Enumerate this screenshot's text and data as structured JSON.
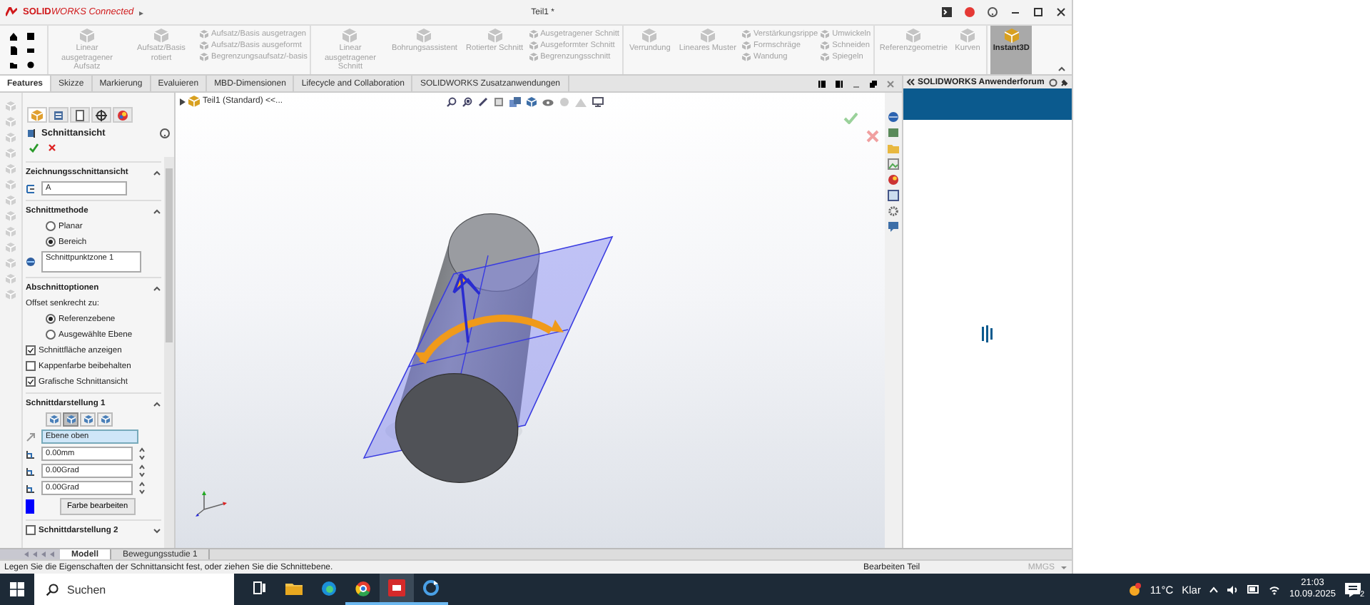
{
  "title_bar": {
    "logo": "**SOLID**WORKS Connected",
    "expand_arrow": "▸",
    "document": "Teil1 *"
  },
  "ribbon": {
    "groups": [
      {
        "tools": [
          {
            "kind": "large",
            "label": "Linear ausgetragener Aufsatz",
            "selected": false
          },
          {
            "kind": "large",
            "label": "Aufsatz/Basis rotiert",
            "selected": false
          },
          {
            "kind": "stack",
            "items": [
              "Aufsatz/Basis ausgetragen",
              "Aufsatz/Basis ausgeformt",
              "Begrenzungsaufsatz/-basis"
            ]
          }
        ]
      },
      {
        "tools": [
          {
            "kind": "large",
            "label": "Linear ausgetragener Schnitt",
            "selected": false
          },
          {
            "kind": "large",
            "label": "Bohrungsassistent",
            "selected": false
          },
          {
            "kind": "large",
            "label": "Rotierter Schnitt",
            "selected": false
          },
          {
            "kind": "stack",
            "items": [
              "Ausgetragener Schnitt",
              "Ausgeformter Schnitt",
              "Begrenzungsschnitt"
            ]
          }
        ]
      },
      {
        "tools": [
          {
            "kind": "large",
            "label": "Verrundung",
            "selected": false
          },
          {
            "kind": "large",
            "label": "Lineares Muster",
            "selected": false
          },
          {
            "kind": "stack",
            "items": [
              "Verstärkungsrippe",
              "Formschräge",
              "Wandung"
            ]
          },
          {
            "kind": "stack",
            "items": [
              "Umwickeln",
              "Schneiden",
              "Spiegeln"
            ]
          }
        ]
      },
      {
        "tools": [
          {
            "kind": "large",
            "label": "Referenzgeometrie",
            "selected": false
          },
          {
            "kind": "large",
            "label": "Kurven",
            "selected": false
          }
        ]
      },
      {
        "tools": [
          {
            "kind": "large",
            "label": "Instant3D",
            "selected": true
          }
        ]
      }
    ]
  },
  "command_tabs": [
    {
      "label": "Features",
      "selected": true
    },
    {
      "label": "Skizze",
      "selected": false
    },
    {
      "label": "Markierung",
      "selected": false
    },
    {
      "label": "Evaluieren",
      "selected": false
    },
    {
      "label": "MBD-Dimensionen",
      "selected": false
    },
    {
      "label": "Lifecycle and Collaboration",
      "selected": false
    },
    {
      "label": "SOLIDWORKS Zusatzanwendungen",
      "selected": false
    }
  ],
  "property_manager": {
    "title": "Schnittansicht",
    "sections": [
      {
        "title": "Zeichnungsschnittansicht",
        "expanded": true,
        "items": [
          {
            "kind": "field",
            "value": "A"
          }
        ]
      },
      {
        "title": "Schnittmethode",
        "expanded": true,
        "items": [
          {
            "kind": "radio",
            "label": "Planar",
            "selected": false
          },
          {
            "kind": "radio",
            "label": "Bereich",
            "selected": true
          },
          {
            "kind": "list",
            "value": "Schnittpunktzone 1"
          }
        ]
      },
      {
        "title": "Abschnittoptionen",
        "expanded": true,
        "items": [
          {
            "kind": "label",
            "text": "Offset senkrecht zu:"
          },
          {
            "kind": "radio",
            "label": "Referenzebene",
            "selected": true
          },
          {
            "kind": "radio",
            "label": "Ausgewählte Ebene",
            "selected": false
          },
          {
            "kind": "checkbox",
            "label": "Schnittfläche anzeigen",
            "checked": true
          },
          {
            "kind": "checkbox",
            "label": "Kappenfarbe beibehalten",
            "checked": false
          },
          {
            "kind": "checkbox",
            "label": "Grafische Schnittansicht",
            "checked": true
          }
        ]
      },
      {
        "title": "Schnittdarstellung 1",
        "expanded": true,
        "items": [
          {
            "kind": "modes",
            "buttons": [
              {
                "selected": false
              },
              {
                "selected": true
              },
              {
                "selected": false
              },
              {
                "selected": false
              }
            ]
          },
          {
            "kind": "plane",
            "value": "Ebene oben"
          },
          {
            "kind": "spinner",
            "value": "0.00mm"
          },
          {
            "kind": "spinner",
            "value": "0.00Grad"
          },
          {
            "kind": "spinner",
            "value": "0.00Grad"
          },
          {
            "kind": "color",
            "color": "#0000ff",
            "button": "Farbe bearbeiten"
          }
        ]
      },
      {
        "title": "Schnittdarstellung 2",
        "kind": "checkbox-section",
        "checked": false,
        "expanded": false
      }
    ]
  },
  "viewport": {
    "tree_label": "Teil1 (Standard) <<..."
  },
  "task_pane": {
    "title": "SOLIDWORKS Anwenderforum"
  },
  "bottom_tabs": [
    {
      "label": "Modell",
      "selected": true
    },
    {
      "label": "Bewegungsstudie 1",
      "selected": false
    }
  ],
  "status_bar": {
    "message": "Legen Sie die Eigenschaften der Schnittansicht fest, oder ziehen Sie die Schnittebene.",
    "mode": "Bearbeiten Teil",
    "units": "MMGS"
  },
  "taskbar": {
    "search_placeholder": "Suchen",
    "apps": [
      {
        "kind": "task-view",
        "running": false,
        "selected": false
      },
      {
        "kind": "folder",
        "running": false,
        "selected": false
      },
      {
        "kind": "swirl-browser",
        "running": false,
        "selected": false
      },
      {
        "kind": "round-browser",
        "running": true,
        "selected": false
      },
      {
        "kind": "cad-app",
        "running": true,
        "selected": true
      },
      {
        "kind": "sync-app",
        "running": true,
        "selected": false
      }
    ],
    "temperature": "11°C",
    "weather": "Klar",
    "time": "21:03",
    "date": "10.09.2025",
    "notifications": "2"
  }
}
